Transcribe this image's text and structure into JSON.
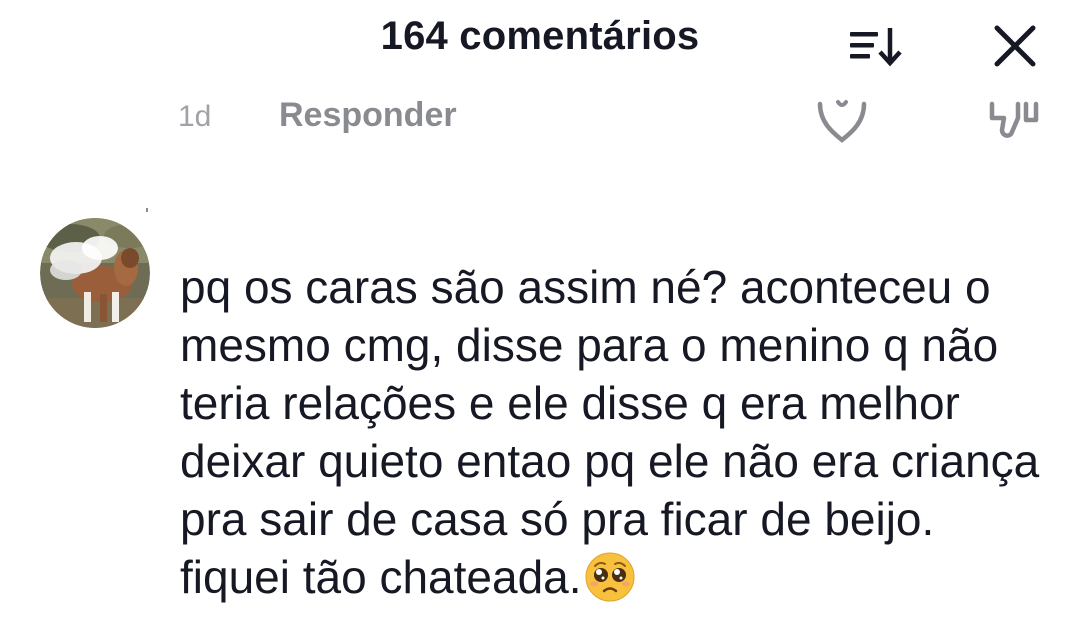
{
  "header": {
    "title": "164 comentários",
    "sort_icon": "sort-descending-icon",
    "close_icon": "close-icon"
  },
  "previous_comment_meta": {
    "time": "1d",
    "reply_label": "Responder",
    "like_icon": "heart-outline-icon",
    "dislike_icon": "thumbs-down-icon"
  },
  "comment": {
    "avatar": "pony-avatar",
    "text": "pq os caras são assim né? aconteceu o mesmo cmg, disse para o menino q não teria relações e ele disse q era melhor deixar quieto entao pq ele não era criança pra sair de casa só pra ficar de beijo. fiquei tão chateada.",
    "emoji": "pleading-face-emoji"
  },
  "colors": {
    "text_primary": "#161823",
    "text_secondary": "#8a8b91",
    "background": "#ffffff"
  }
}
